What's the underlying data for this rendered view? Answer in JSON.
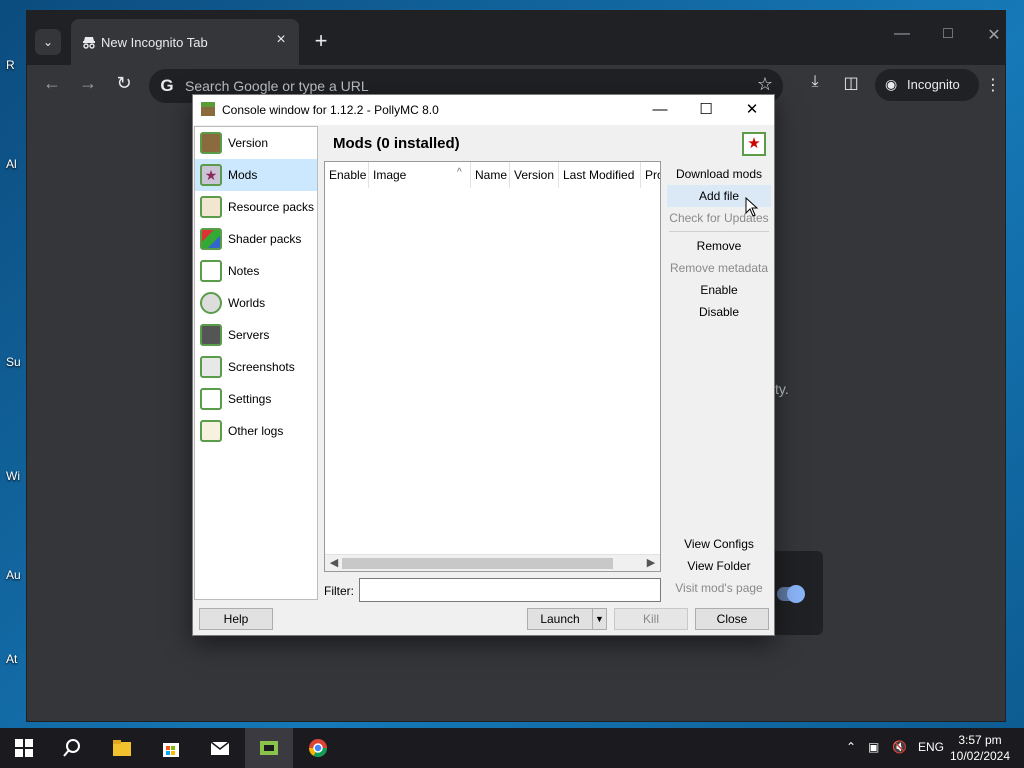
{
  "desktop": {
    "icon_labels": [
      "R",
      "Al",
      "Su",
      "Wi",
      "Au",
      "At"
    ]
  },
  "chrome": {
    "tab_title": "New Incognito Tab",
    "new_tab_symbol": "+",
    "omnibox_placeholder": "Search Google or type a URL",
    "incognito_label": "Incognito",
    "content_text": "ty.",
    "icons": [
      "tab-list-icon",
      "incognito-tab-icon",
      "close-icon",
      "plus-icon",
      "minimize-icon",
      "maximize-icon",
      "close-window-icon",
      "back-icon",
      "forward-icon",
      "reload-icon",
      "google-icon",
      "bookmark-star-icon",
      "download-icon",
      "side-panel-icon",
      "incognito-icon",
      "menu-dots-icon"
    ]
  },
  "console": {
    "title": "Console window for 1.12.2 - PollyMC 8.0",
    "sidebar": [
      {
        "label": "Version",
        "icon": "version-icon",
        "active": false
      },
      {
        "label": "Mods",
        "icon": "mods-icon",
        "active": true
      },
      {
        "label": "Resource packs",
        "icon": "resource-packs-icon",
        "active": false
      },
      {
        "label": "Shader packs",
        "icon": "shader-packs-icon",
        "active": false
      },
      {
        "label": "Notes",
        "icon": "notes-icon",
        "active": false
      },
      {
        "label": "Worlds",
        "icon": "worlds-icon",
        "active": false
      },
      {
        "label": "Servers",
        "icon": "servers-icon",
        "active": false
      },
      {
        "label": "Screenshots",
        "icon": "screenshots-icon",
        "active": false
      },
      {
        "label": "Settings",
        "icon": "settings-icon",
        "active": false
      },
      {
        "label": "Other logs",
        "icon": "other-logs-icon",
        "active": false
      }
    ],
    "page_title": "Mods (0 installed)",
    "table": {
      "columns": [
        "Enable",
        "Image",
        "Name",
        "Version",
        "Last Modified",
        "Pro"
      ],
      "rows": []
    },
    "filter": {
      "label": "Filter:",
      "value": ""
    },
    "actions": {
      "download_mods": "Download mods",
      "add_file": "Add file",
      "check_updates": "Check for Updates",
      "remove": "Remove",
      "remove_metadata": "Remove metadata",
      "enable": "Enable",
      "disable": "Disable",
      "view_configs": "View Configs",
      "view_folder": "View Folder",
      "visit_page": "Visit mod's page"
    },
    "buttons": {
      "help": "Help",
      "launch": "Launch",
      "kill": "Kill",
      "close": "Close"
    }
  },
  "taskbar": {
    "apps": [
      "windows-start-icon",
      "search-icon",
      "file-explorer-icon",
      "microsoft-store-icon",
      "mail-icon",
      "pollymc-icon",
      "chrome-icon"
    ],
    "language": "ENG",
    "time": "3:57 pm",
    "date": "10/02/2024"
  }
}
